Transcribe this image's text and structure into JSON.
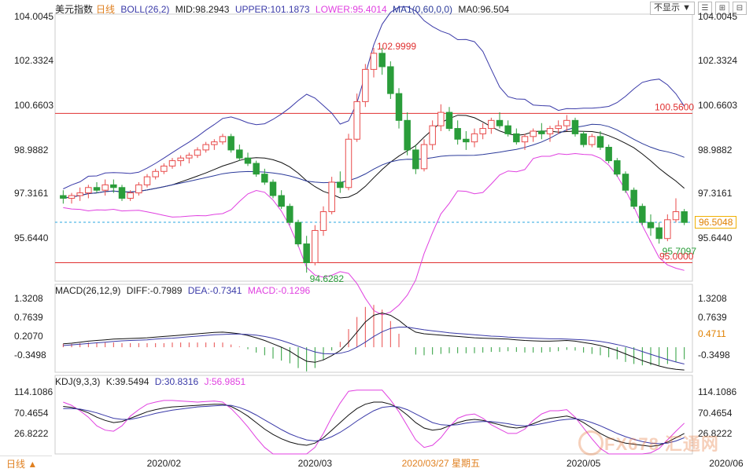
{
  "panels": {
    "main": {
      "title": "美元指数",
      "period": "日线",
      "boll": {
        "label": "BOLL(26,2)",
        "mid": "MID:98.2943",
        "upper": "UPPER:101.1873",
        "lower": "LOWER:95.4014"
      },
      "ma": {
        "label": "MA1(0,60,0,0)",
        "value": "MA0:96.504"
      },
      "y_ticks": [
        "104.0045",
        "102.3324",
        "100.6603",
        "98.9882",
        "97.3161",
        "95.6440"
      ],
      "current_price": "96.5048",
      "annotations": {
        "high": "102.9999",
        "low": "94.6282",
        "recent_low": "95.7097",
        "level_upper": "100.5600",
        "level_lower": "95.0000"
      }
    },
    "macd": {
      "label": "MACD(26,12,9)",
      "diff": "DIFF:-0.7989",
      "dea": "DEA:-0.7341",
      "macd": "MACD:-0.1296",
      "y_ticks": [
        "1.3208",
        "0.7639",
        "0.2070",
        "-0.3498"
      ],
      "right_ticks": [
        "1.3208",
        "0.7639",
        "0.4711",
        "-0.3498"
      ]
    },
    "kdj": {
      "label": "KDJ(9,3,3)",
      "k": "K:39.5494",
      "d": "D:30.8316",
      "j": "J:56.9851",
      "y_ticks": [
        "114.1086",
        "70.4654",
        "26.8222"
      ]
    }
  },
  "x_axis": {
    "labels": [
      "2020/02",
      "2020/03",
      "2020/03/27 星期五",
      "2020/05",
      "2020/06"
    ]
  },
  "toolbar": {
    "display_select": "不显示",
    "buttons": [
      "☰",
      "⊞",
      "⊟"
    ]
  },
  "period_button": "日线 ▲",
  "watermark": "FX678 汇通网",
  "colors": {
    "up": "#e84b4b",
    "down": "#2a9d3a",
    "boll_upper": "#3a3aa8",
    "boll_mid": "#111111",
    "boll_lower": "#e040e0",
    "ma": "#2b3a9a",
    "level_line": "#e03030",
    "price_dash": "#2aa7e0"
  },
  "chart_data": [
    {
      "type": "candlestick",
      "title": "美元指数",
      "ylim": [
        94.4,
        104.2
      ],
      "candles": [
        {
          "o": 97.5,
          "h": 97.7,
          "l": 97.2,
          "c": 97.4
        },
        {
          "o": 97.4,
          "h": 97.6,
          "l": 97.2,
          "c": 97.5
        },
        {
          "o": 97.5,
          "h": 97.8,
          "l": 97.3,
          "c": 97.6
        },
        {
          "o": 97.6,
          "h": 97.9,
          "l": 97.4,
          "c": 97.8
        },
        {
          "o": 97.8,
          "h": 98.0,
          "l": 97.6,
          "c": 97.7
        },
        {
          "o": 97.7,
          "h": 98.1,
          "l": 97.5,
          "c": 97.9
        },
        {
          "o": 97.9,
          "h": 98.1,
          "l": 97.6,
          "c": 97.8
        },
        {
          "o": 97.8,
          "h": 97.9,
          "l": 97.3,
          "c": 97.4
        },
        {
          "o": 97.4,
          "h": 97.7,
          "l": 97.3,
          "c": 97.6
        },
        {
          "o": 97.6,
          "h": 98.0,
          "l": 97.5,
          "c": 97.9
        },
        {
          "o": 97.9,
          "h": 98.3,
          "l": 97.8,
          "c": 98.2
        },
        {
          "o": 98.2,
          "h": 98.5,
          "l": 98.1,
          "c": 98.4
        },
        {
          "o": 98.4,
          "h": 98.7,
          "l": 98.3,
          "c": 98.6
        },
        {
          "o": 98.6,
          "h": 98.9,
          "l": 98.5,
          "c": 98.8
        },
        {
          "o": 98.8,
          "h": 99.0,
          "l": 98.6,
          "c": 98.9
        },
        {
          "o": 98.9,
          "h": 99.1,
          "l": 98.7,
          "c": 99.0
        },
        {
          "o": 99.0,
          "h": 99.3,
          "l": 98.9,
          "c": 99.2
        },
        {
          "o": 99.2,
          "h": 99.5,
          "l": 99.1,
          "c": 99.4
        },
        {
          "o": 99.4,
          "h": 99.6,
          "l": 99.2,
          "c": 99.5
        },
        {
          "o": 99.5,
          "h": 99.8,
          "l": 99.4,
          "c": 99.7
        },
        {
          "o": 99.7,
          "h": 99.8,
          "l": 99.1,
          "c": 99.2
        },
        {
          "o": 99.2,
          "h": 99.4,
          "l": 98.8,
          "c": 98.9
        },
        {
          "o": 98.9,
          "h": 99.1,
          "l": 98.6,
          "c": 98.7
        },
        {
          "o": 98.7,
          "h": 98.8,
          "l": 98.2,
          "c": 98.3
        },
        {
          "o": 98.3,
          "h": 98.5,
          "l": 97.9,
          "c": 98.0
        },
        {
          "o": 98.0,
          "h": 98.1,
          "l": 97.4,
          "c": 97.5
        },
        {
          "o": 97.5,
          "h": 97.7,
          "l": 97.0,
          "c": 97.1
        },
        {
          "o": 97.1,
          "h": 97.2,
          "l": 96.4,
          "c": 96.5
        },
        {
          "o": 96.5,
          "h": 96.6,
          "l": 95.6,
          "c": 95.7
        },
        {
          "o": 95.7,
          "h": 96.0,
          "l": 94.63,
          "c": 95.0
        },
        {
          "o": 95.0,
          "h": 96.4,
          "l": 94.9,
          "c": 96.2
        },
        {
          "o": 96.2,
          "h": 97.1,
          "l": 96.0,
          "c": 96.9
        },
        {
          "o": 96.9,
          "h": 98.2,
          "l": 96.8,
          "c": 98.0
        },
        {
          "o": 98.0,
          "h": 98.4,
          "l": 97.6,
          "c": 97.8
        },
        {
          "o": 97.8,
          "h": 99.8,
          "l": 97.7,
          "c": 99.6
        },
        {
          "o": 99.6,
          "h": 101.3,
          "l": 99.5,
          "c": 101.0
        },
        {
          "o": 101.0,
          "h": 102.4,
          "l": 100.8,
          "c": 102.2
        },
        {
          "o": 102.2,
          "h": 103.0,
          "l": 101.9,
          "c": 102.8
        },
        {
          "o": 102.8,
          "h": 103.0,
          "l": 102.0,
          "c": 102.3
        },
        {
          "o": 102.3,
          "h": 102.5,
          "l": 101.1,
          "c": 101.3
        },
        {
          "o": 101.3,
          "h": 101.5,
          "l": 100.0,
          "c": 100.3
        },
        {
          "o": 100.3,
          "h": 100.6,
          "l": 99.0,
          "c": 99.2
        },
        {
          "o": 99.2,
          "h": 99.4,
          "l": 98.3,
          "c": 98.5
        },
        {
          "o": 98.5,
          "h": 99.6,
          "l": 98.4,
          "c": 99.4
        },
        {
          "o": 99.4,
          "h": 100.3,
          "l": 99.2,
          "c": 100.1
        },
        {
          "o": 100.1,
          "h": 100.9,
          "l": 99.9,
          "c": 100.6
        },
        {
          "o": 100.6,
          "h": 100.8,
          "l": 99.9,
          "c": 100.0
        },
        {
          "o": 100.0,
          "h": 100.3,
          "l": 99.4,
          "c": 99.6
        },
        {
          "o": 99.6,
          "h": 99.9,
          "l": 99.2,
          "c": 99.5
        },
        {
          "o": 99.5,
          "h": 100.0,
          "l": 99.3,
          "c": 99.8
        },
        {
          "o": 99.8,
          "h": 100.2,
          "l": 99.6,
          "c": 100.0
        },
        {
          "o": 100.0,
          "h": 100.4,
          "l": 99.8,
          "c": 100.3
        },
        {
          "o": 100.3,
          "h": 100.6,
          "l": 100.0,
          "c": 100.1
        },
        {
          "o": 100.1,
          "h": 100.3,
          "l": 99.7,
          "c": 99.8
        },
        {
          "o": 99.8,
          "h": 100.0,
          "l": 99.4,
          "c": 99.5
        },
        {
          "o": 99.5,
          "h": 99.8,
          "l": 99.2,
          "c": 99.7
        },
        {
          "o": 99.7,
          "h": 100.0,
          "l": 99.5,
          "c": 99.9
        },
        {
          "o": 99.9,
          "h": 100.2,
          "l": 99.6,
          "c": 99.8
        },
        {
          "o": 99.8,
          "h": 100.1,
          "l": 99.5,
          "c": 100.0
        },
        {
          "o": 100.0,
          "h": 100.3,
          "l": 99.8,
          "c": 100.1
        },
        {
          "o": 100.1,
          "h": 100.5,
          "l": 99.9,
          "c": 100.3
        },
        {
          "o": 100.3,
          "h": 100.4,
          "l": 99.7,
          "c": 99.8
        },
        {
          "o": 99.8,
          "h": 99.9,
          "l": 99.3,
          "c": 99.4
        },
        {
          "o": 99.4,
          "h": 99.8,
          "l": 99.3,
          "c": 99.7
        },
        {
          "o": 99.7,
          "h": 99.9,
          "l": 99.2,
          "c": 99.3
        },
        {
          "o": 99.3,
          "h": 99.4,
          "l": 98.7,
          "c": 98.8
        },
        {
          "o": 98.8,
          "h": 98.9,
          "l": 98.2,
          "c": 98.3
        },
        {
          "o": 98.3,
          "h": 98.4,
          "l": 97.6,
          "c": 97.7
        },
        {
          "o": 97.7,
          "h": 97.8,
          "l": 97.0,
          "c": 97.1
        },
        {
          "o": 97.1,
          "h": 97.2,
          "l": 96.4,
          "c": 96.5
        },
        {
          "o": 96.5,
          "h": 96.8,
          "l": 96.0,
          "c": 96.3
        },
        {
          "o": 96.3,
          "h": 96.5,
          "l": 95.71,
          "c": 95.9
        },
        {
          "o": 95.9,
          "h": 96.8,
          "l": 95.8,
          "c": 96.6
        },
        {
          "o": 96.6,
          "h": 97.4,
          "l": 96.5,
          "c": 96.9
        },
        {
          "o": 96.9,
          "h": 97.0,
          "l": 96.4,
          "c": 96.5
        }
      ]
    },
    {
      "type": "line",
      "title": "MACD(26,12,9)",
      "ylim": [
        -0.7,
        1.5
      ],
      "series": [
        {
          "name": "DIFF",
          "values": [
            0.1,
            0.12,
            0.15,
            0.18,
            0.2,
            0.22,
            0.24,
            0.25,
            0.26,
            0.27,
            0.28,
            0.3,
            0.32,
            0.34,
            0.36,
            0.38,
            0.4,
            0.42,
            0.44,
            0.45,
            0.43,
            0.4,
            0.35,
            0.28,
            0.2,
            0.1,
            0.0,
            -0.12,
            -0.28,
            -0.42,
            -0.45,
            -0.38,
            -0.25,
            -0.1,
            0.15,
            0.45,
            0.75,
            0.95,
            1.02,
            0.95,
            0.8,
            0.6,
            0.45,
            0.4,
            0.38,
            0.36,
            0.34,
            0.32,
            0.3,
            0.28,
            0.27,
            0.26,
            0.25,
            0.24,
            0.22,
            0.2,
            0.19,
            0.18,
            0.18,
            0.19,
            0.2,
            0.18,
            0.14,
            0.1,
            0.05,
            -0.02,
            -0.1,
            -0.2,
            -0.3,
            -0.4,
            -0.48,
            -0.56,
            -0.62,
            -0.66,
            -0.68
          ]
        },
        {
          "name": "DEA",
          "values": [
            0.05,
            0.07,
            0.09,
            0.11,
            0.13,
            0.15,
            0.17,
            0.19,
            0.2,
            0.21,
            0.22,
            0.24,
            0.26,
            0.27,
            0.29,
            0.31,
            0.33,
            0.35,
            0.37,
            0.38,
            0.39,
            0.39,
            0.38,
            0.36,
            0.32,
            0.27,
            0.2,
            0.12,
            0.03,
            -0.06,
            -0.14,
            -0.19,
            -0.2,
            -0.18,
            -0.12,
            0.0,
            0.15,
            0.32,
            0.46,
            0.56,
            0.6,
            0.6,
            0.56,
            0.52,
            0.49,
            0.46,
            0.43,
            0.41,
            0.39,
            0.37,
            0.35,
            0.33,
            0.32,
            0.3,
            0.29,
            0.28,
            0.27,
            0.26,
            0.25,
            0.25,
            0.24,
            0.23,
            0.22,
            0.2,
            0.17,
            0.13,
            0.08,
            0.02,
            -0.05,
            -0.13,
            -0.21,
            -0.29,
            -0.37,
            -0.44,
            -0.5
          ]
        }
      ]
    },
    {
      "type": "line",
      "title": "KDJ(9,3,3)",
      "ylim": [
        0,
        125
      ],
      "series": [
        {
          "name": "K",
          "values": [
            88,
            86,
            82,
            76,
            68,
            62,
            58,
            60,
            66,
            72,
            78,
            82,
            85,
            87,
            88,
            89,
            90,
            91,
            92,
            92,
            88,
            80,
            70,
            58,
            46,
            36,
            28,
            22,
            18,
            16,
            20,
            30,
            44,
            58,
            72,
            84,
            92,
            96,
            96,
            92,
            84,
            72,
            58,
            48,
            44,
            46,
            52,
            58,
            62,
            64,
            62,
            58,
            54,
            50,
            48,
            50,
            56,
            62,
            66,
            68,
            70,
            66,
            58,
            48,
            38,
            30,
            24,
            20,
            18,
            16,
            14,
            16,
            22,
            30,
            38
          ]
        },
        {
          "name": "D",
          "values": [
            84,
            84,
            83,
            80,
            76,
            71,
            66,
            64,
            64,
            67,
            71,
            75,
            78,
            81,
            83,
            85,
            87,
            88,
            89,
            90,
            90,
            86,
            80,
            72,
            63,
            54,
            45,
            37,
            31,
            26,
            24,
            26,
            32,
            40,
            50,
            61,
            71,
            80,
            86,
            88,
            87,
            82,
            74,
            66,
            58,
            54,
            53,
            54,
            57,
            59,
            60,
            60,
            58,
            56,
            53,
            52,
            53,
            56,
            59,
            62,
            64,
            65,
            63,
            58,
            52,
            45,
            38,
            32,
            27,
            23,
            20,
            19,
            20,
            24,
            30
          ]
        },
        {
          "name": "J",
          "values": [
            96,
            90,
            80,
            68,
            52,
            44,
            42,
            52,
            70,
            82,
            92,
            96,
            99,
            99,
            98,
            97,
            96,
            97,
            98,
            96,
            84,
            68,
            50,
            30,
            12,
            0,
            0,
            0,
            0,
            0,
            12,
            38,
            68,
            94,
            116,
            118,
            118,
            118,
            118,
            100,
            78,
            52,
            26,
            12,
            16,
            30,
            50,
            66,
            72,
            74,
            66,
            54,
            46,
            38,
            38,
            46,
            62,
            74,
            80,
            80,
            82,
            68,
            48,
            28,
            10,
            0,
            0,
            0,
            0,
            0,
            2,
            10,
            26,
            42,
            57
          ]
        }
      ]
    }
  ]
}
